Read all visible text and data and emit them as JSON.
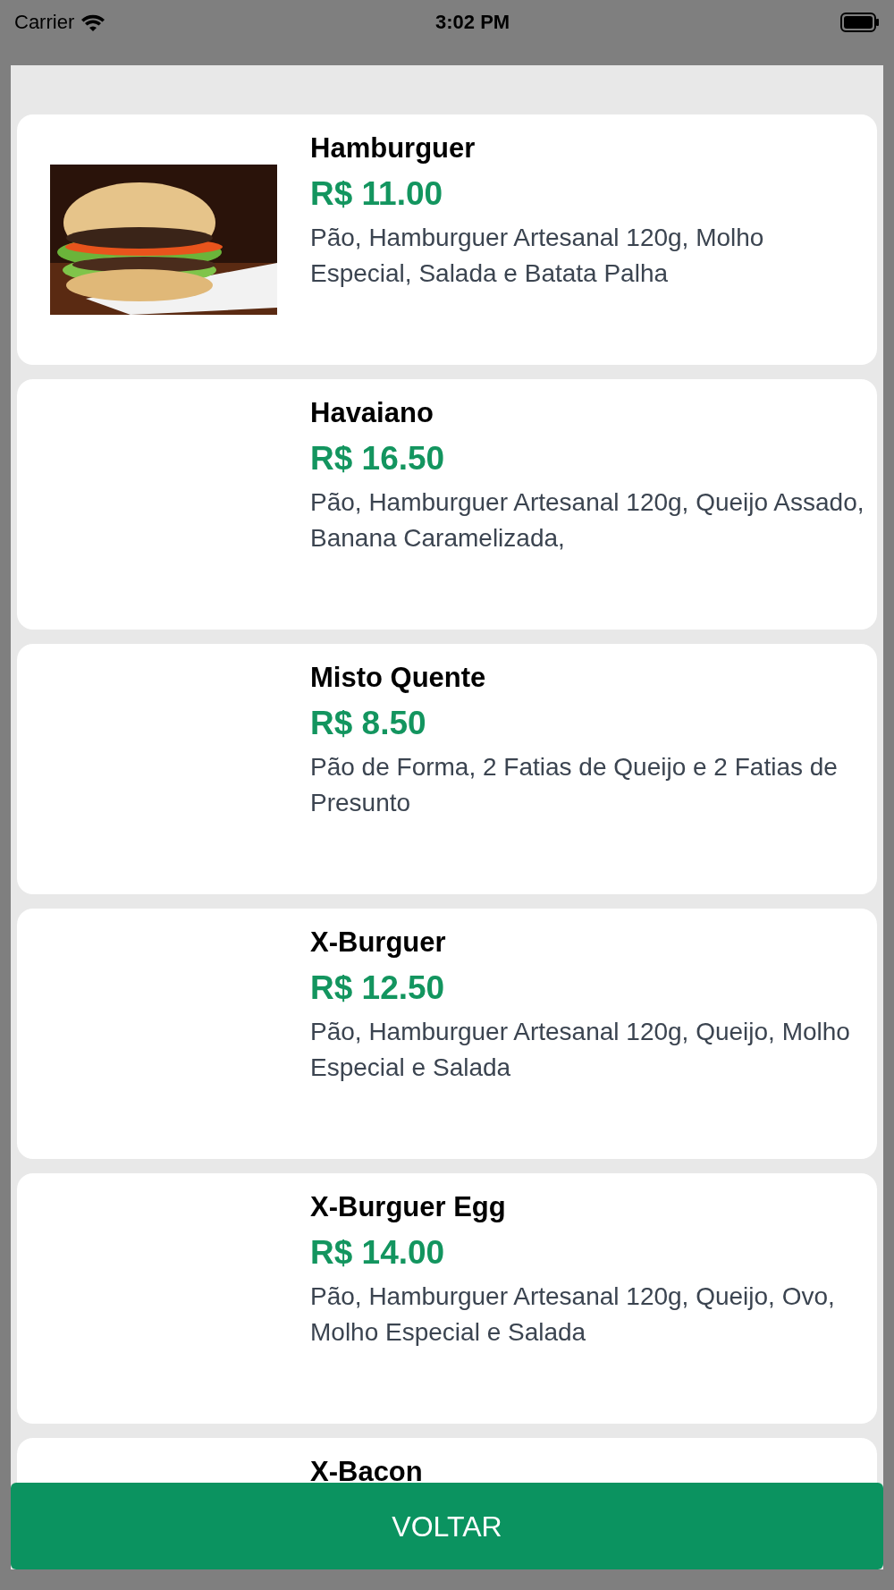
{
  "status_bar": {
    "carrier": "Carrier",
    "time": "3:02 PM"
  },
  "products": [
    {
      "name": "Hamburguer",
      "price": "R$ 11.00",
      "description": "Pão, Hamburguer Artesanal 120g, Molho Especial, Salada e Batata Palha",
      "kind": "picture"
    },
    {
      "name": "Havaiano",
      "price": "R$ 16.50",
      "description": "Pão, Hamburguer Artesanal 120g, Queijo Assado, Banana Caramelizada,"
    },
    {
      "name": "Misto Quente",
      "price": "R$ 8.50",
      "description": "Pão de Forma, 2 Fatias de Queijo e 2 Fatias de Presunto"
    },
    {
      "name": "X-Burguer",
      "price": "R$ 12.50",
      "description": "Pão, Hamburguer Artesanal 120g, Queijo, Molho Especial e Salada"
    },
    {
      "name": "X-Burguer Egg",
      "price": "R$ 14.00",
      "description": "Pão, Hamburguer Artesanal 120g, Queijo, Ovo, Molho Especial e Salada"
    },
    {
      "name": "X-Bacon"
    }
  ],
  "button": {
    "label": "VOLTAR"
  }
}
